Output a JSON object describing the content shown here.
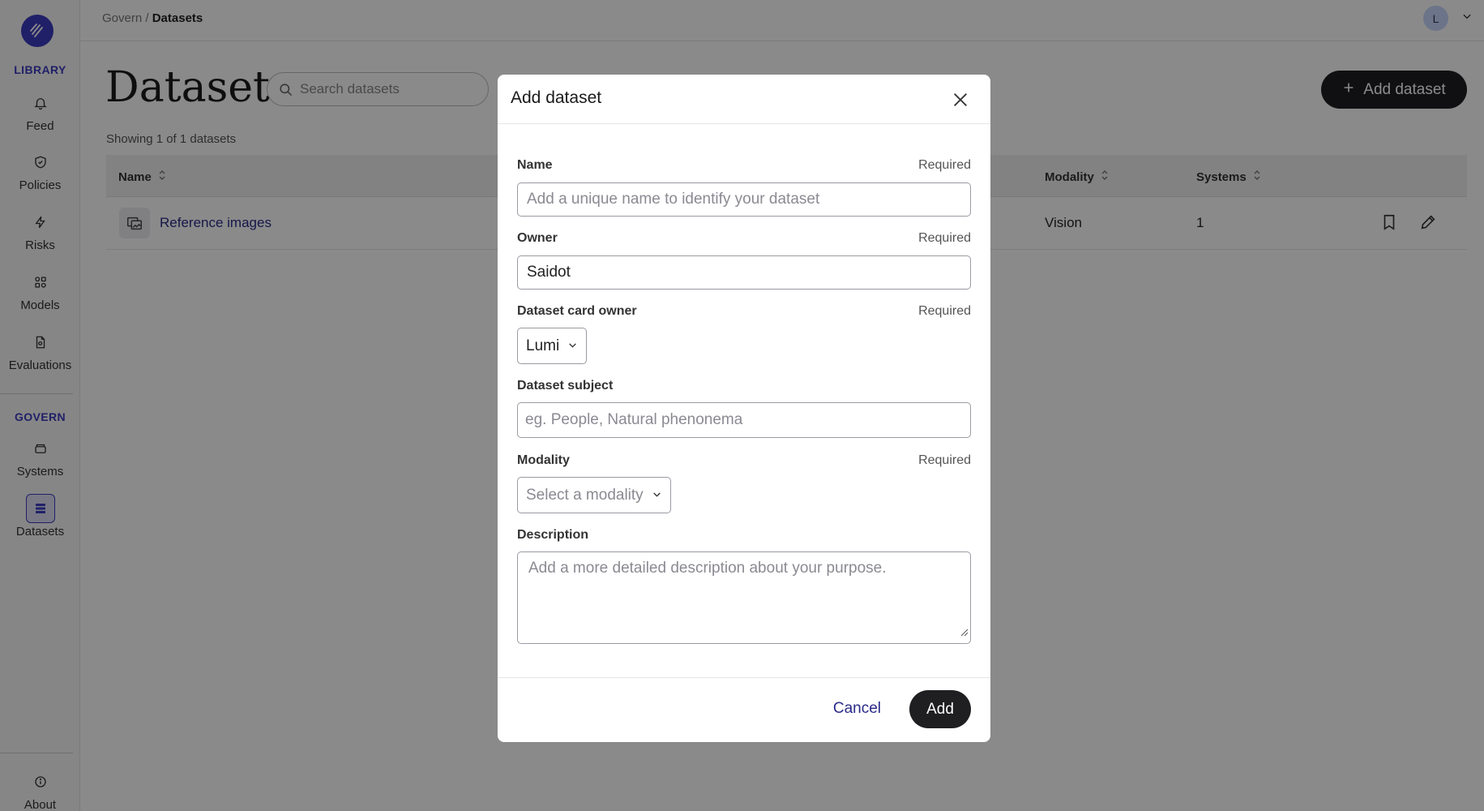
{
  "sidebar": {
    "library_label": "LIBRARY",
    "govern_label": "GOVERN",
    "items": [
      {
        "label": "Feed",
        "icon": "bell-icon"
      },
      {
        "label": "Policies",
        "icon": "shield-icon"
      },
      {
        "label": "Risks",
        "icon": "lightning-icon"
      },
      {
        "label": "Models",
        "icon": "models-icon"
      },
      {
        "label": "Evaluations",
        "icon": "document-icon"
      },
      {
        "label": "Systems",
        "icon": "layers-icon"
      },
      {
        "label": "Datasets",
        "icon": "database-icon"
      },
      {
        "label": "About",
        "icon": "info-icon"
      }
    ],
    "active": "Datasets",
    "accent_color": "#3c3cc0"
  },
  "topbar": {
    "breadcrumb_parent": "Govern",
    "breadcrumb_separator": " / ",
    "breadcrumb_current": "Datasets",
    "avatar_initial": "L"
  },
  "main": {
    "title": "Datasets",
    "search_placeholder": "Search datasets",
    "add_button_label": "Add dataset",
    "showing_text": "Showing 1 of 1 datasets",
    "table": {
      "columns": [
        "Name",
        "Modality",
        "Systems"
      ],
      "rows": [
        {
          "name": "Reference images",
          "modality": "Vision",
          "systems": "1"
        }
      ]
    }
  },
  "modal": {
    "title": "Add dataset",
    "required_text": "Required",
    "fields": {
      "name": {
        "label": "Name",
        "placeholder": "Add a unique name to identify your dataset"
      },
      "owner": {
        "label": "Owner",
        "value": "Saidot"
      },
      "card_owner": {
        "label": "Dataset card owner",
        "value": "Lumi"
      },
      "subject": {
        "label": "Dataset subject",
        "placeholder": "eg. People, Natural phenonema"
      },
      "modality": {
        "label": "Modality",
        "placeholder": "Select a modality"
      },
      "description": {
        "label": "Description",
        "placeholder": "Add a more detailed description about your purpose."
      }
    },
    "cancel_label": "Cancel",
    "add_label": "Add"
  }
}
